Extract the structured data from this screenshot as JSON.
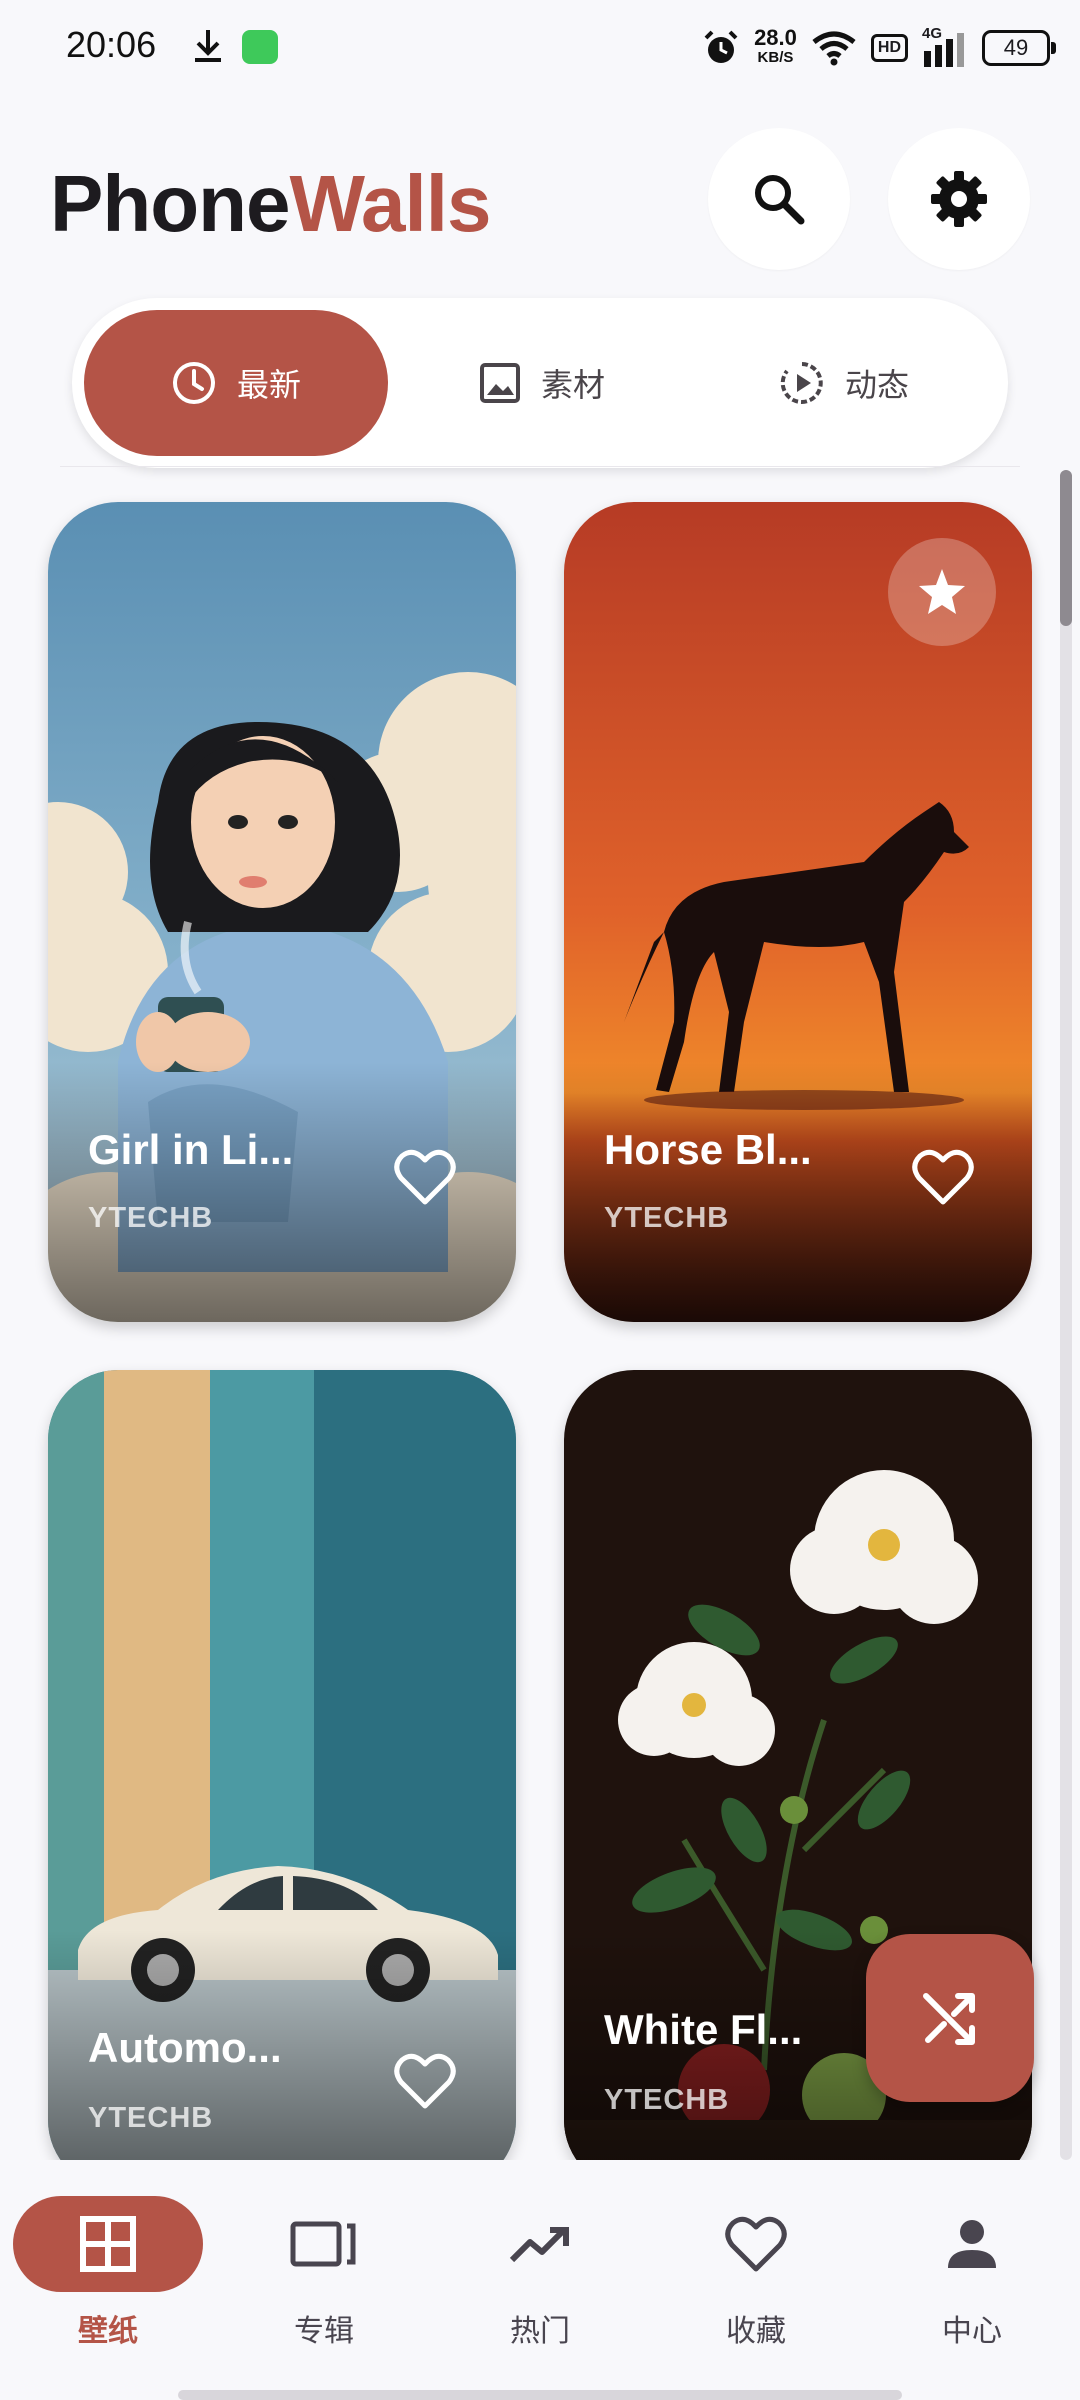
{
  "status_bar": {
    "time": "20:06",
    "net_speed": "28.0",
    "net_unit": "KB/S",
    "hd": "HD",
    "network": "4G",
    "battery": "49"
  },
  "header": {
    "brand_part1": "Phone",
    "brand_part2": "Walls",
    "search_icon": "search-icon",
    "settings_icon": "gear-icon"
  },
  "tabs": [
    {
      "label": "最新",
      "icon": "clock-icon",
      "active": true
    },
    {
      "label": "素材",
      "icon": "image-icon",
      "active": false
    },
    {
      "label": "动态",
      "icon": "play-circle-icon",
      "active": false
    }
  ],
  "wallpapers": [
    {
      "title": "Girl in Li...",
      "author": "YTECHB",
      "favorited": false,
      "featured": false
    },
    {
      "title": "Horse Bl...",
      "author": "YTECHB",
      "favorited": false,
      "featured": true
    },
    {
      "title": "Automo...",
      "author": "YTECHB",
      "favorited": false,
      "featured": false
    },
    {
      "title": "White Fl...",
      "author": "YTECHB",
      "favorited": false,
      "featured": false
    }
  ],
  "fab": {
    "icon": "shuffle-icon"
  },
  "bottom_nav": [
    {
      "label": "壁纸",
      "icon": "grid-icon",
      "active": true
    },
    {
      "label": "专辑",
      "icon": "album-icon",
      "active": false
    },
    {
      "label": "热门",
      "icon": "trending-icon",
      "active": false
    },
    {
      "label": "收藏",
      "icon": "heart-icon",
      "active": false
    },
    {
      "label": "中心",
      "icon": "person-icon",
      "active": false
    }
  ],
  "colors": {
    "accent": "#b45447",
    "background": "#f8f8fb"
  }
}
